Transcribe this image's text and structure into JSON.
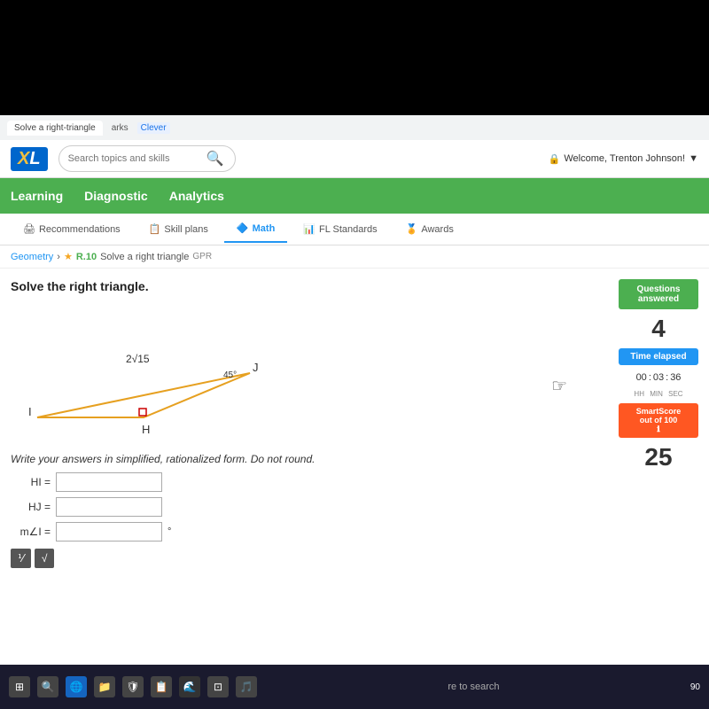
{
  "browser": {
    "tab_text": "Solve a right-triangle",
    "bookmarks": [
      "arks",
      "Clever"
    ]
  },
  "header": {
    "logo": "IXL",
    "search_placeholder": "Search topics and skills",
    "welcome_text": "Welcome, Trenton Johnson!",
    "user_icon": "👤"
  },
  "nav": {
    "items": [
      "Learning",
      "Diagnostic",
      "Analytics"
    ]
  },
  "subtabs": {
    "items": [
      "Recommendations",
      "Skill plans",
      "Math",
      "FL Standards",
      "Awards"
    ],
    "active": "Math"
  },
  "breadcrumb": {
    "section": "Geometry",
    "skill_code": "R.10",
    "skill_name": "Solve a right triangle",
    "tag": "GPR"
  },
  "problem": {
    "title": "Solve the right triangle.",
    "triangle": {
      "vertices": {
        "I": "I",
        "J": "J",
        "H": "H"
      },
      "top_label": "2√15",
      "angle_label": "45°"
    },
    "instruction": "Write your answers in simplified, rationalized form. Do not round.",
    "inputs": [
      {
        "label": "HI =",
        "id": "hi",
        "value": ""
      },
      {
        "label": "HJ =",
        "id": "hj",
        "value": ""
      },
      {
        "label": "m∠I =",
        "id": "mi",
        "value": "",
        "suffix": "°"
      }
    ],
    "buttons": [
      "⅟",
      "√"
    ]
  },
  "sidebar": {
    "questions_answered_label": "Questions answered",
    "questions_count": "4",
    "time_elapsed_label": "Time elapsed",
    "time_hh": "00",
    "time_mm": "03",
    "time_ss": "36",
    "time_labels": [
      "HH",
      "MIN",
      "SEC"
    ],
    "smartscore_label": "SmartScore",
    "smartscore_sub": "out of 100",
    "smartscore_value": "25"
  },
  "taskbar": {
    "search_text": "re to search",
    "clock_time": "90",
    "icons": [
      "⊞",
      "🌐",
      "📁",
      "🛡",
      "📋",
      "🌊",
      "⊡",
      "🎵"
    ]
  }
}
